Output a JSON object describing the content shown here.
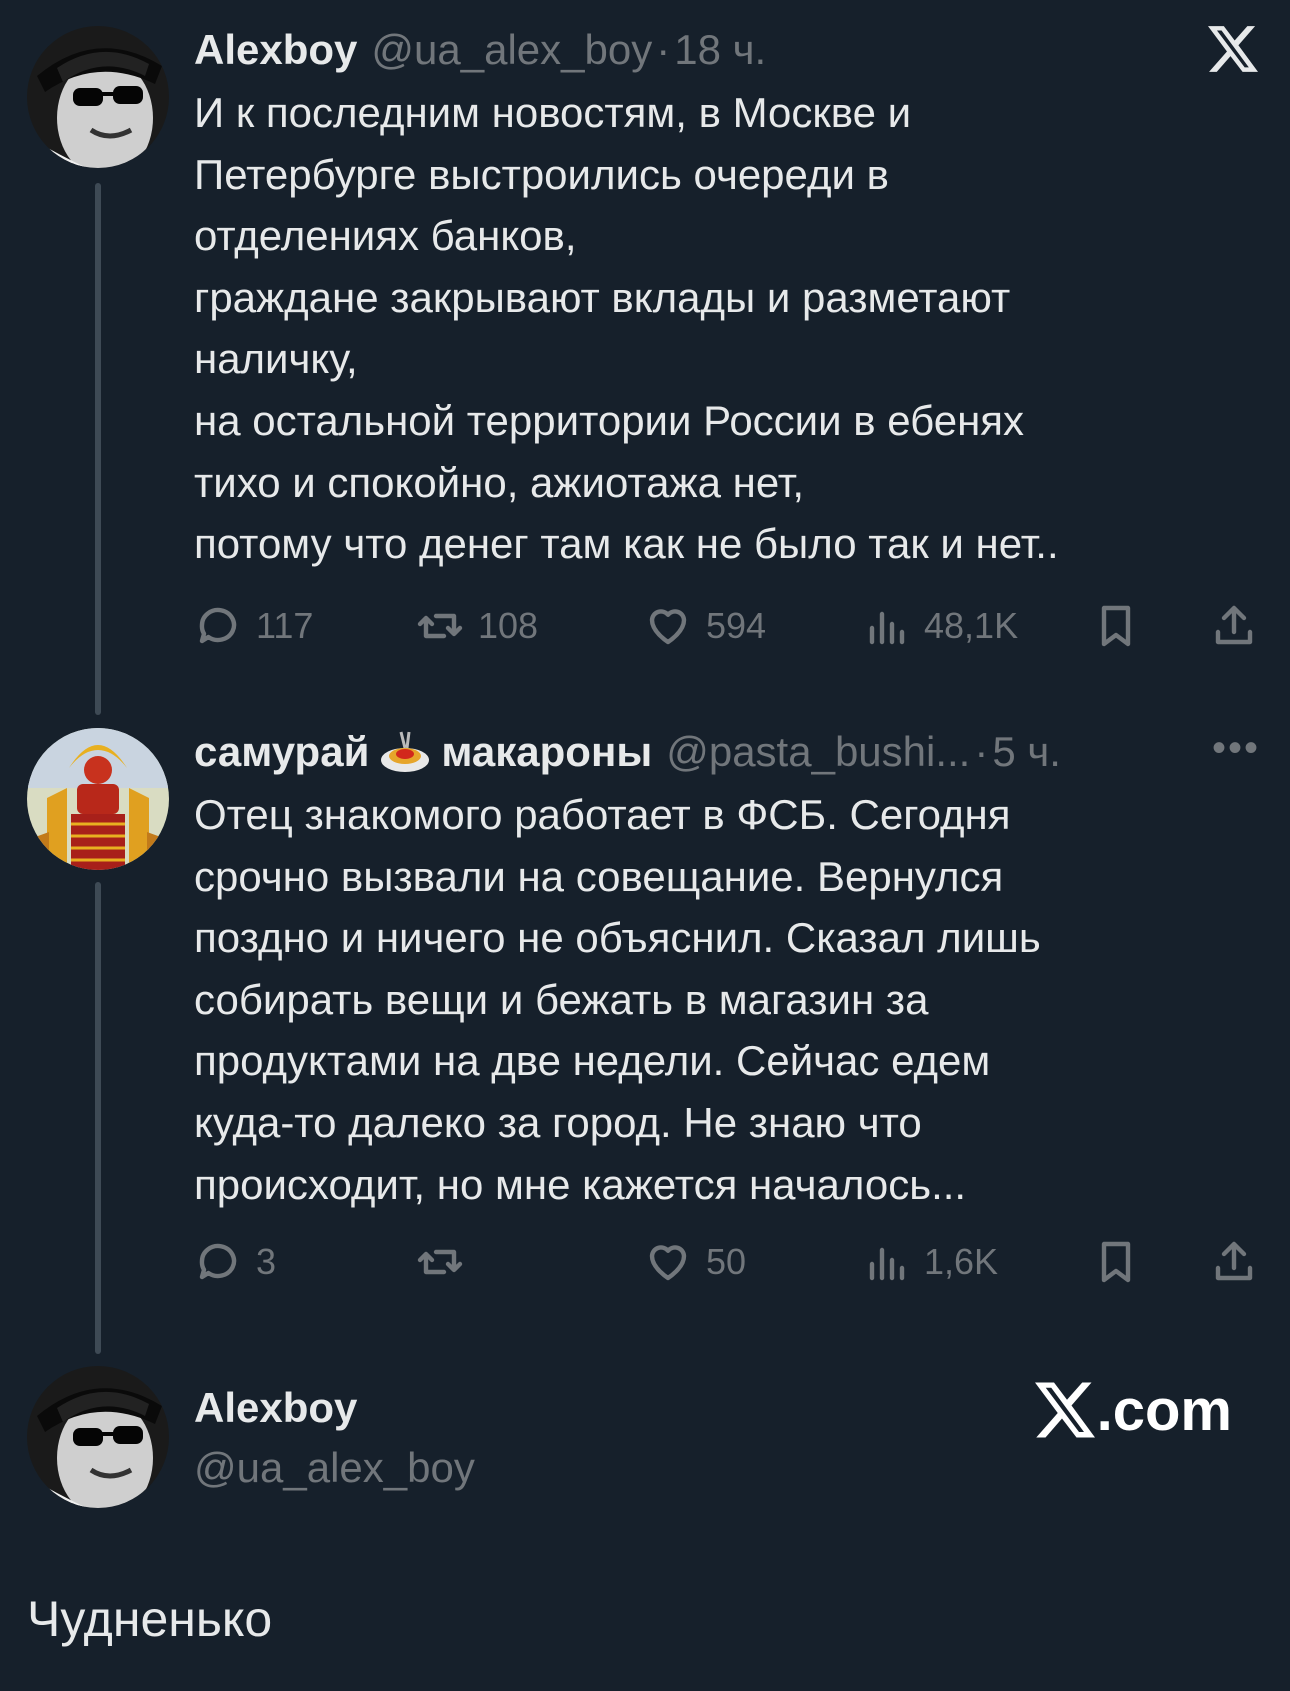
{
  "tweet1": {
    "name": "Alexboy",
    "handle": "@ua_alex_boy",
    "time": "18 ч.",
    "lines": [
      "И к последним новостям, в Москве и",
      "Петербурге выстроились очереди в",
      "отделениях банков,",
      "граждане закрывают вклады и разметают",
      "наличку,",
      "на остальной территории России в ебенях",
      "тихо и спокойно, ажиотажа нет,",
      "потому что денег там как не было так и нет.."
    ],
    "replies": "117",
    "reposts": "108",
    "likes": "594",
    "views": "48,1K"
  },
  "tweet2": {
    "name_part1": "самурай",
    "name_part2": "макароны",
    "emoji_icon": "spaghetti-emoji",
    "handle": "@pasta_bushi...",
    "time": "5 ч.",
    "more": "•••",
    "lines": [
      "Отец знакомого работает в ФСБ. Сегодня",
      "срочно вызвали на совещание. Вернулся",
      "поздно и ничего не объяснил. Сказал лишь",
      "собирать вещи и бежать в магазин за",
      "продуктами на две недели. Сейчас едем",
      "куда-то далеко за город. Не знаю что",
      "происходит, но мне кажется началось..."
    ],
    "replies": "3",
    "reposts": "",
    "likes": "50",
    "views": "1,6K"
  },
  "footer_card": {
    "name": "Alexboy",
    "handle": "@ua_alex_boy",
    "site": ".com"
  },
  "caption": "Чудненько",
  "colors": {
    "background": "#16202b",
    "text": "#e7e9ea",
    "muted": "#71767b",
    "thread_line": "#3e4a55"
  }
}
